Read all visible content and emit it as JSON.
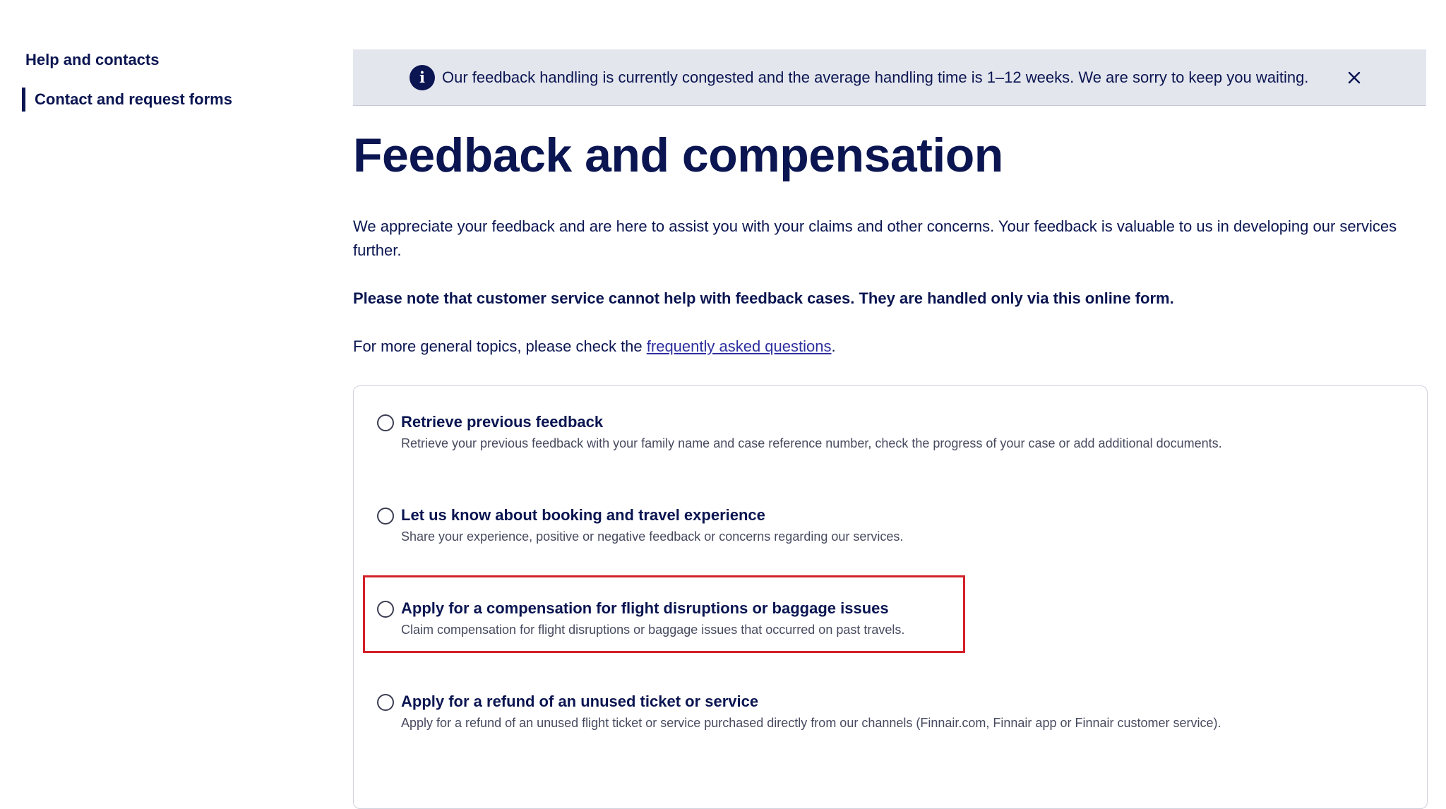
{
  "sidebar": {
    "items": [
      {
        "label": "Help and contacts"
      },
      {
        "label": "Contact and request forms"
      }
    ]
  },
  "banner": {
    "icon": "info-icon",
    "text": "Our feedback handling is currently congested and the average handling time is 1–12 weeks. We are sorry to keep you waiting.",
    "close_icon": "close-icon"
  },
  "page": {
    "title": "Feedback and compensation",
    "intro": "We appreciate your feedback and are here to assist you with your claims and other concerns. Your feedback is valuable to us in developing our services further.",
    "note": "Please note that customer service cannot help with feedback cases. They are handled only via this online form.",
    "faq_prefix": "For more general topics, please check the ",
    "faq_link": "frequently asked questions",
    "faq_suffix": "."
  },
  "options": [
    {
      "title": "Retrieve previous feedback",
      "description": "Retrieve your previous feedback with your family name and case reference number, check the progress of your case or add additional documents."
    },
    {
      "title": "Let us know about booking and travel experience",
      "description": "Share your experience, positive or negative feedback or concerns regarding our services."
    },
    {
      "title": "Apply for a compensation for flight disruptions or baggage issues",
      "description": "Claim compensation for flight disruptions or baggage issues that occurred on past travels."
    },
    {
      "title": "Apply for a refund of an unused ticket or service",
      "description": "Apply for a refund of an unused flight ticket or service purchased directly from our channels (Finnair.com, Finnair app or Finnair customer service)."
    }
  ],
  "colors": {
    "brand_navy": "#0a1551",
    "banner_bg": "#e4e6ee",
    "highlight": "#d4202a",
    "link": "#2d2f9e"
  }
}
